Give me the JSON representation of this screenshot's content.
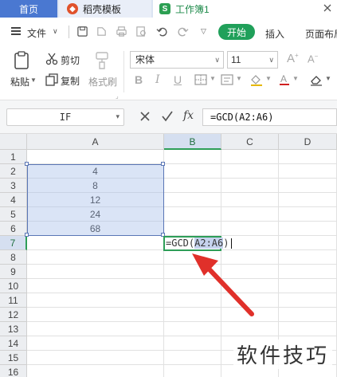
{
  "tabs": {
    "home": "首页",
    "doc": "稻壳模板",
    "book": "工作簿1"
  },
  "menu": {
    "file": "文件",
    "start": "开始",
    "insert": "插入",
    "page_layout": "页面布局"
  },
  "ribbon": {
    "paste": "粘贴",
    "cut": "剪切",
    "copy": "复制",
    "format_painter": "格式刷",
    "font_name": "宋体",
    "font_size": "11"
  },
  "formula_bar": {
    "name_box": "IF",
    "fx": "fx",
    "formula": "=GCD(A2:A6)"
  },
  "grid": {
    "columns": [
      "A",
      "B",
      "C",
      "D"
    ],
    "rows": [
      "1",
      "2",
      "3",
      "4",
      "5",
      "6",
      "7",
      "8",
      "9",
      "10",
      "11",
      "12",
      "13",
      "14",
      "15",
      "16"
    ],
    "a_values": [
      "4",
      "8",
      "12",
      "24",
      "68"
    ],
    "edit_prefix": "=GCD(",
    "edit_ref": "A2:A6",
    "edit_suffix": ")"
  },
  "watermark": "软件技巧",
  "colors": {
    "accent_green": "#2e9e58",
    "start_button": "#20a05a",
    "home_tab": "#4a78d1",
    "selection": "#adc4ea",
    "arrow": "#e0302a"
  }
}
